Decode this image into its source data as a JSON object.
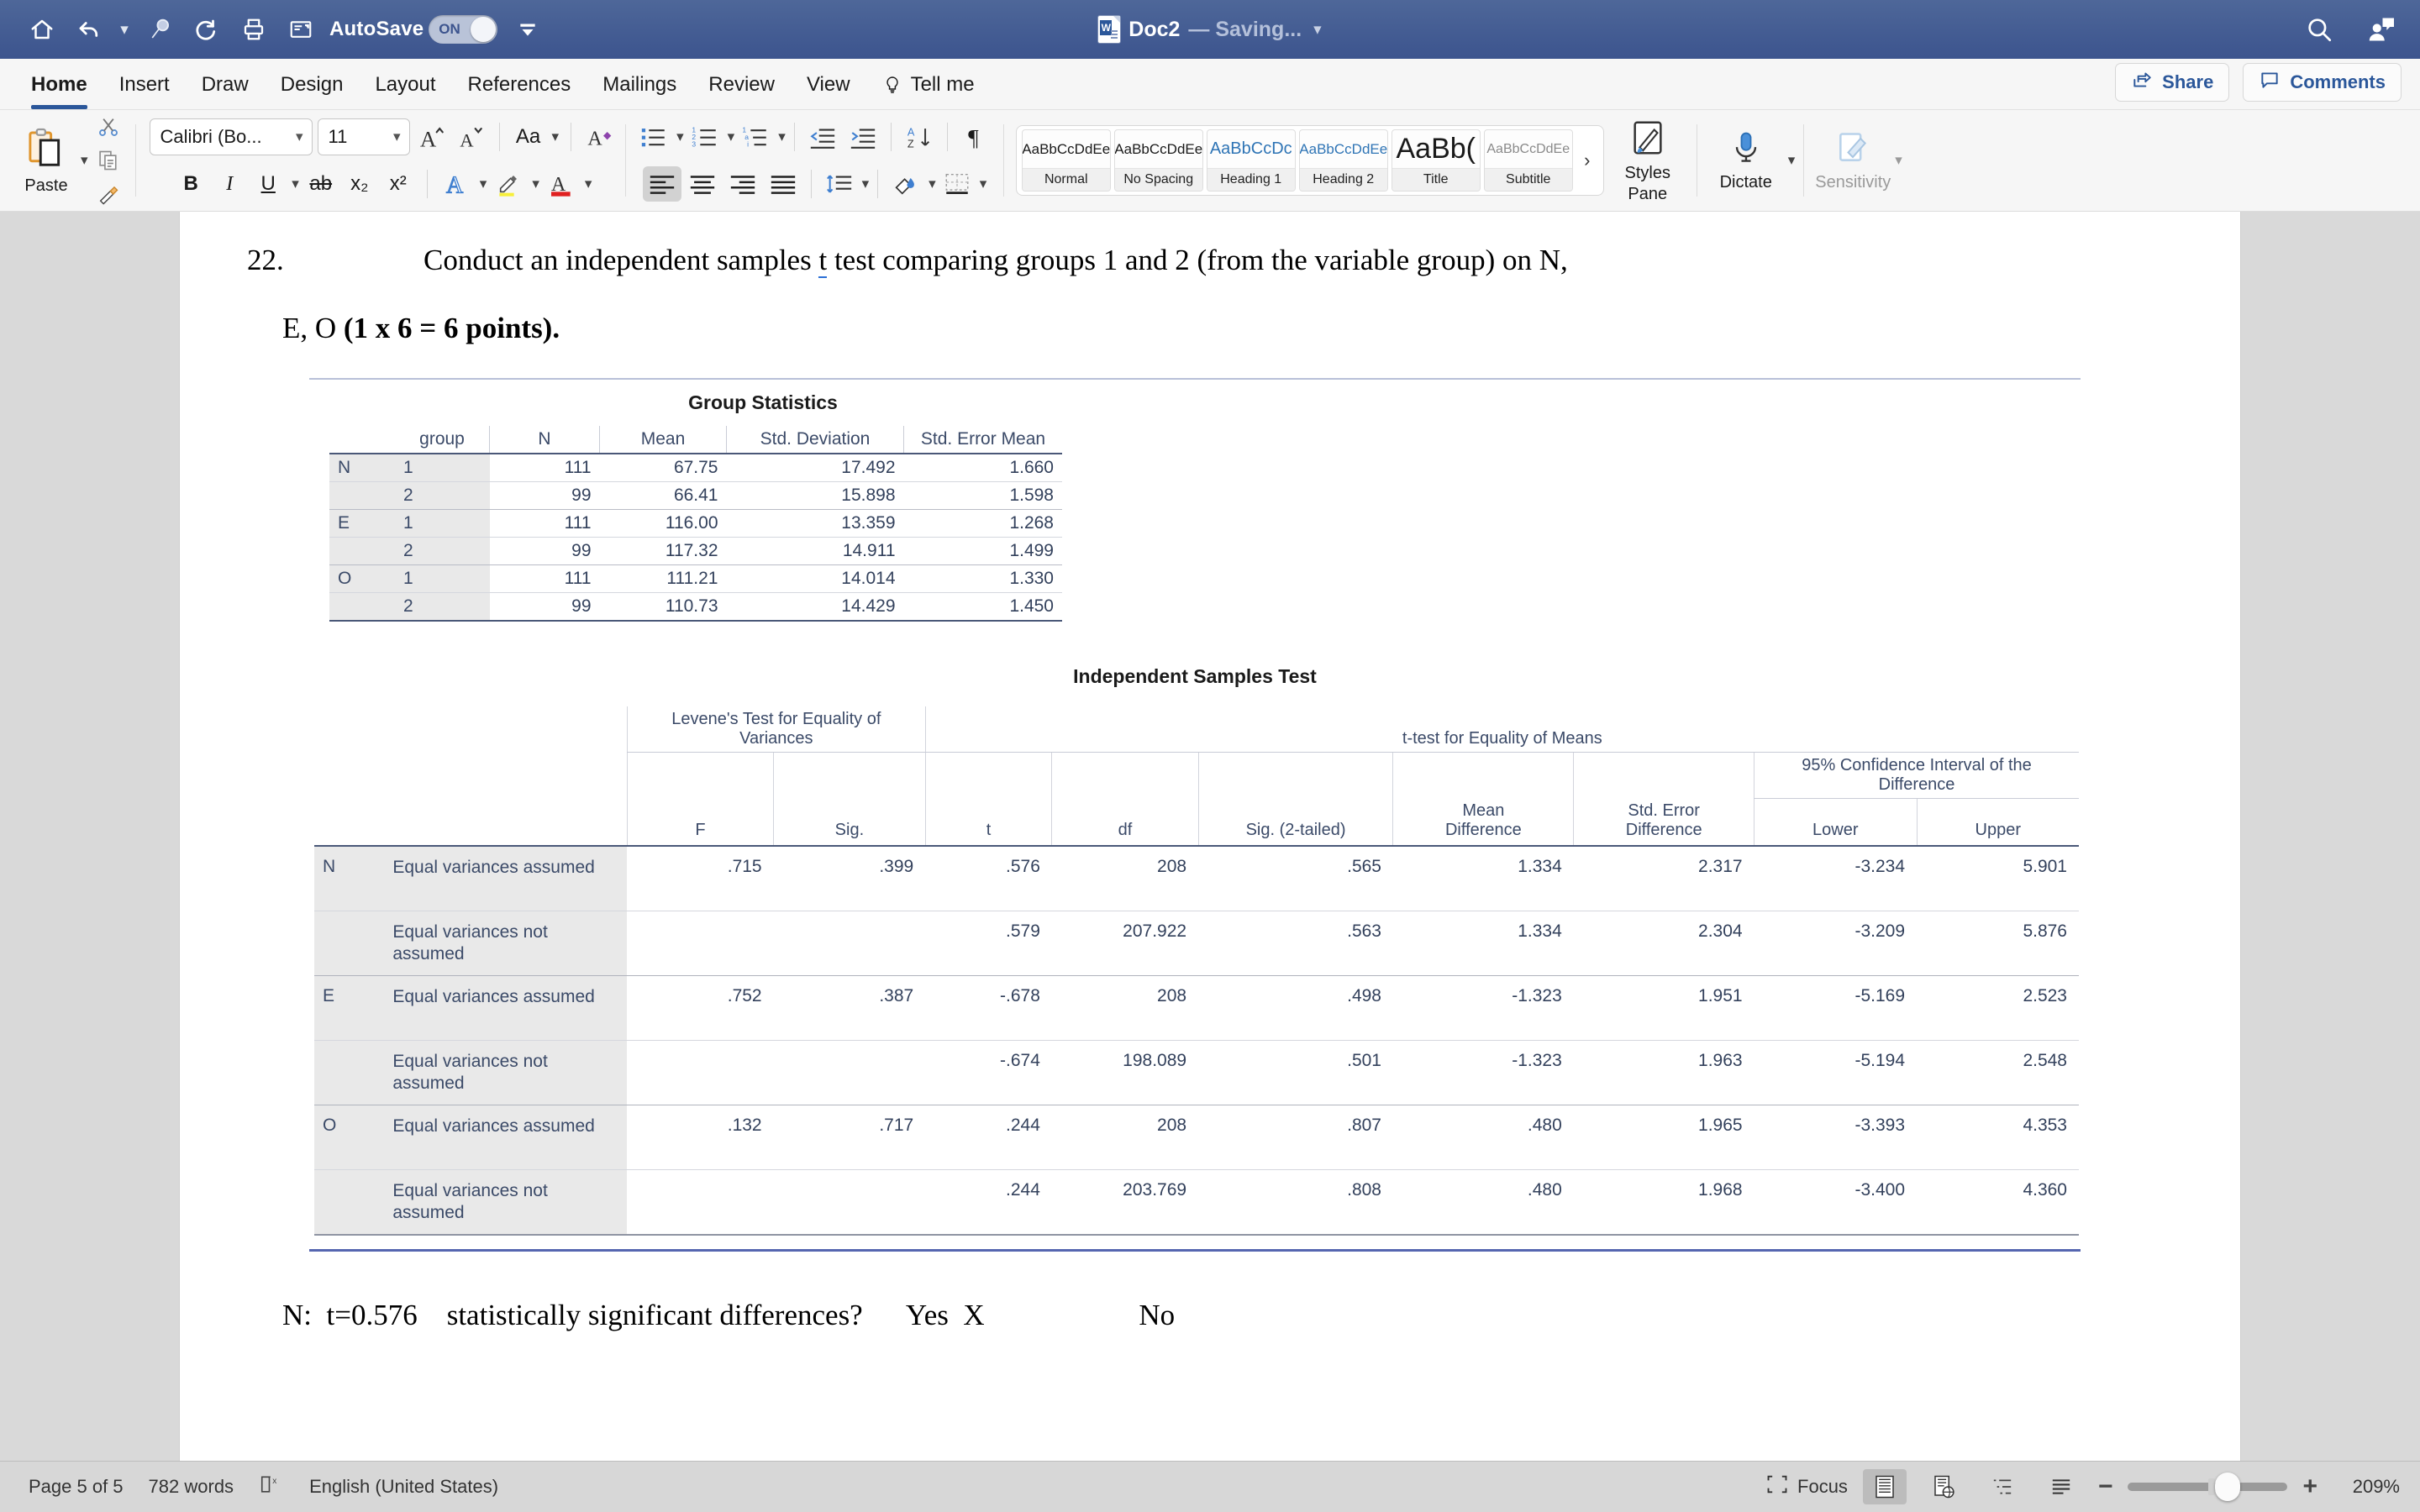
{
  "titlebar": {
    "icons": [
      "home-icon",
      "undo-icon",
      "undo-caret",
      "customize-icon",
      "redo-icon",
      "print-icon",
      "print-preview-icon"
    ],
    "autosave_label": "AutoSave",
    "autosave_state": "ON",
    "document_name": "Doc2",
    "document_status": "— Saving...",
    "search_icon": "search-icon",
    "account_icon": "account-icon",
    "background_color": "#3c548e"
  },
  "ribbon_tabs": {
    "items": [
      {
        "label": "Home",
        "active": true
      },
      {
        "label": "Insert",
        "active": false
      },
      {
        "label": "Draw",
        "active": false
      },
      {
        "label": "Design",
        "active": false
      },
      {
        "label": "Layout",
        "active": false
      },
      {
        "label": "References",
        "active": false
      },
      {
        "label": "Mailings",
        "active": false
      },
      {
        "label": "Review",
        "active": false
      },
      {
        "label": "View",
        "active": false
      },
      {
        "label": "Tell me",
        "active": false
      }
    ],
    "share_label": "Share",
    "comments_label": "Comments",
    "accent_color": "#2b579a"
  },
  "ribbon": {
    "clipboard": {
      "paste_label": "Paste",
      "cut_icon": "scissors-icon",
      "copy_icon": "copy-icon",
      "format_painter_icon": "format-painter-icon"
    },
    "font": {
      "font_name": "Calibri (Bo...",
      "font_size": "11",
      "grow_font_icon": "grow-font-icon",
      "shrink_font_icon": "shrink-font-icon",
      "change_case_label": "Aa",
      "clear_formatting_icon": "clear-formatting-icon",
      "bold_label": "B",
      "italic_label": "I",
      "underline_label": "U",
      "strikethrough_label": "ab",
      "subscript_label": "x₂",
      "superscript_label": "x²",
      "text_effects_icon": "text-effects-icon",
      "highlight_icon": "text-highlight-icon",
      "font_color_icon": "font-color-icon"
    },
    "paragraph": {
      "bullets_icon": "bullet-list-icon",
      "numbering_icon": "numbered-list-icon",
      "multilevel_icon": "multilevel-list-icon",
      "decrease_indent_icon": "decrease-indent-icon",
      "increase_indent_icon": "increase-indent-icon",
      "sort_icon": "sort-az-icon",
      "show_marks_icon": "paragraph-mark-icon",
      "align_left_icon": "align-left-icon",
      "align_center_icon": "align-center-icon",
      "align_right_icon": "align-right-icon",
      "justify_icon": "justify-icon",
      "line_spacing_icon": "line-spacing-icon",
      "shading_icon": "shading-icon",
      "borders_icon": "borders-icon"
    },
    "styles": [
      {
        "preview": "AaBbCcDdEe",
        "name": "Normal"
      },
      {
        "preview": "AaBbCcDdEe",
        "name": "No Spacing"
      },
      {
        "preview": "AaBbCcDc",
        "name": "Heading 1"
      },
      {
        "preview": "AaBbCcDdEe",
        "name": "Heading 2"
      },
      {
        "preview": "AaBb(",
        "name": "Title"
      },
      {
        "preview": "AaBbCcDdEe",
        "name": "Subtitle"
      }
    ],
    "styles_pane_label": "Styles\nPane",
    "styles_pane_line1": "Styles",
    "styles_pane_line2": "Pane",
    "dictate_label": "Dictate",
    "sensitivity_label": "Sensitivity"
  },
  "document": {
    "question_number": "22.",
    "paragraph1_a": "Conduct an independent samples ",
    "paragraph1_t": "t",
    "paragraph1_b": " test comparing groups 1 and 2 (from the variable group) on N,",
    "paragraph2_a": "E, O ",
    "paragraph2_bold": "(1 x 6 = 6 points).",
    "bottom_line": "N:  t=0.576    statistically significant differences?      Yes  X                     No"
  },
  "group_statistics": {
    "title": "Group Statistics",
    "columns": [
      "",
      "group",
      "N",
      "Mean",
      "Std. Deviation",
      "Std. Error Mean"
    ],
    "rows": [
      {
        "var": "N",
        "group": "1",
        "n": "111",
        "mean": "67.75",
        "sd": "17.492",
        "sem": "1.660"
      },
      {
        "var": "",
        "group": "2",
        "n": "99",
        "mean": "66.41",
        "sd": "15.898",
        "sem": "1.598"
      },
      {
        "var": "E",
        "group": "1",
        "n": "111",
        "mean": "116.00",
        "sd": "13.359",
        "sem": "1.268"
      },
      {
        "var": "",
        "group": "2",
        "n": "99",
        "mean": "117.32",
        "sd": "14.911",
        "sem": "1.499"
      },
      {
        "var": "O",
        "group": "1",
        "n": "111",
        "mean": "111.21",
        "sd": "14.014",
        "sem": "1.330"
      },
      {
        "var": "",
        "group": "2",
        "n": "99",
        "mean": "110.73",
        "sd": "14.429",
        "sem": "1.450"
      }
    ]
  },
  "independent_samples_test": {
    "title": "Independent Samples Test",
    "span_levene": "Levene's Test for Equality of Variances",
    "span_ttest": "t-test for Equality of Means",
    "span_ci": "95% Confidence Interval of the Difference",
    "columns": [
      "F",
      "Sig.",
      "t",
      "df",
      "Sig. (2-tailed)",
      "Mean Difference",
      "Std. Error Difference",
      "Lower",
      "Upper"
    ],
    "col_mean_diff_l1": "Mean",
    "col_mean_diff_l2": "Difference",
    "col_se_diff_l1": "Std. Error",
    "col_se_diff_l2": "Difference",
    "rows": [
      {
        "var": "N",
        "label": "Equal variances assumed",
        "F": ".715",
        "Sig": ".399",
        "t": ".576",
        "df": "208",
        "sig2": ".565",
        "meandiff": "1.334",
        "sediff": "2.317",
        "lower": "-3.234",
        "upper": "5.901"
      },
      {
        "var": "",
        "label": "Equal variances not assumed",
        "F": "",
        "Sig": "",
        "t": ".579",
        "df": "207.922",
        "sig2": ".563",
        "meandiff": "1.334",
        "sediff": "2.304",
        "lower": "-3.209",
        "upper": "5.876"
      },
      {
        "var": "E",
        "label": "Equal variances assumed",
        "F": ".752",
        "Sig": ".387",
        "t": "-.678",
        "df": "208",
        "sig2": ".498",
        "meandiff": "-1.323",
        "sediff": "1.951",
        "lower": "-5.169",
        "upper": "2.523"
      },
      {
        "var": "",
        "label": "Equal variances not assumed",
        "F": "",
        "Sig": "",
        "t": "-.674",
        "df": "198.089",
        "sig2": ".501",
        "meandiff": "-1.323",
        "sediff": "1.963",
        "lower": "-5.194",
        "upper": "2.548"
      },
      {
        "var": "O",
        "label": "Equal variances assumed",
        "F": ".132",
        "Sig": ".717",
        "t": ".244",
        "df": "208",
        "sig2": ".807",
        "meandiff": ".480",
        "sediff": "1.965",
        "lower": "-3.393",
        "upper": "4.353"
      },
      {
        "var": "",
        "label": "Equal variances not assumed",
        "F": "",
        "Sig": "",
        "t": ".244",
        "df": "203.769",
        "sig2": ".808",
        "meandiff": ".480",
        "sediff": "1.968",
        "lower": "-3.400",
        "upper": "4.360"
      }
    ]
  },
  "statusbar": {
    "page_label": "Page 5 of 5",
    "word_count": "782 words",
    "proofing_icon": "proofing-errors-icon",
    "language": "English (United States)",
    "focus_label": "Focus",
    "print_layout_icon": "print-layout-view-icon",
    "web_layout_icon": "web-layout-view-icon",
    "outline_icon": "outline-view-icon",
    "draft_icon": "draft-view-icon",
    "zoom_out_label": "−",
    "zoom_in_label": "+",
    "zoom_value": "209%"
  }
}
